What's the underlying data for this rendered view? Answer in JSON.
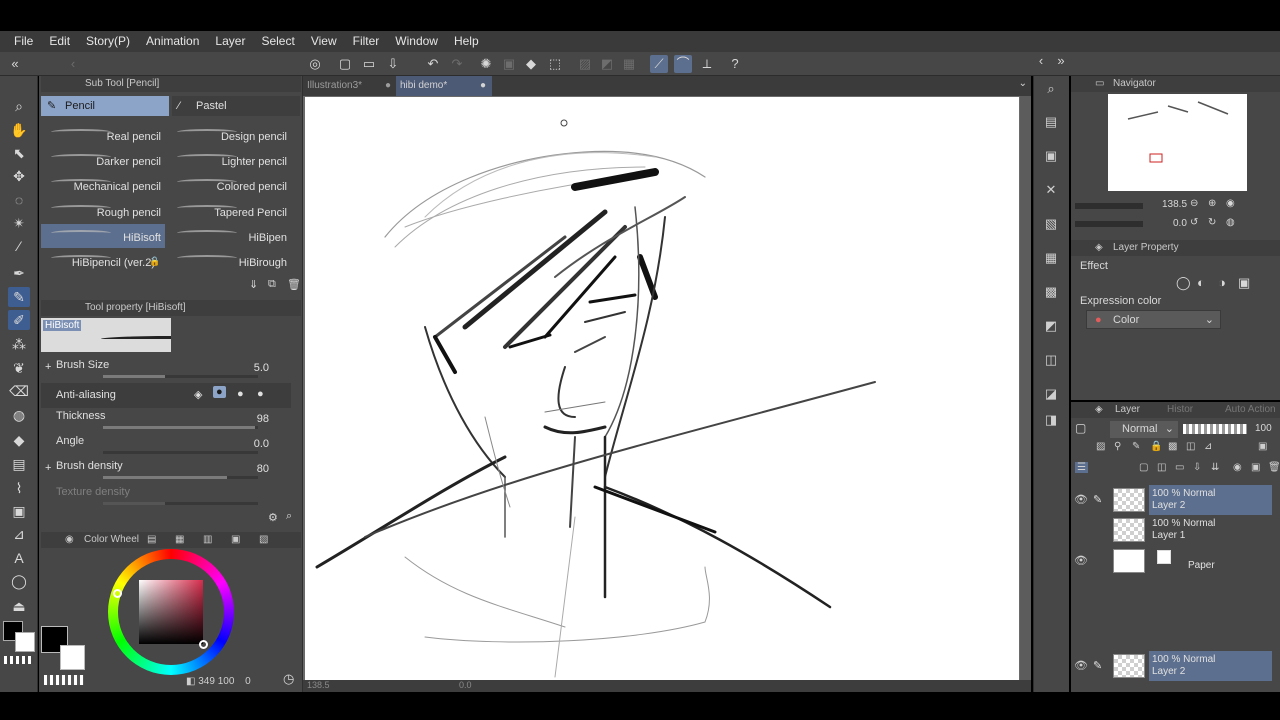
{
  "menu": [
    "File",
    "Edit",
    "Story(P)",
    "Animation",
    "Layer",
    "Select",
    "View",
    "Filter",
    "Window",
    "Help"
  ],
  "subtool": {
    "panel_title": "Sub Tool [Pencil]",
    "tabs": [
      "Pencil",
      "Pastel"
    ],
    "brushes": [
      "Real pencil",
      "Design pencil",
      "Darker pencil",
      "Lighter pencil",
      "Mechanical pencil",
      "Colored pencil",
      "Rough pencil",
      "Tapered Pencil",
      "HiBisoft",
      "HiBipen",
      "HiBipencil (ver.2)",
      "HiBirough"
    ],
    "active_brush": "HiBisoft"
  },
  "tool_property": {
    "title": "Tool property [HiBisoft]",
    "brush_name": "HiBisoft",
    "rows": [
      {
        "label": "Brush Size",
        "value": "5.0",
        "fill": 0.4
      },
      {
        "label": "Anti-aliasing",
        "value": "",
        "fill": 0
      },
      {
        "label": "Thickness",
        "value": "98",
        "fill": 0.98
      },
      {
        "label": "Angle",
        "value": "0.0",
        "fill": 0
      },
      {
        "label": "Brush density",
        "value": "80",
        "fill": 0.8
      },
      {
        "label": "Texture density",
        "value": "",
        "fill": 0.4
      }
    ]
  },
  "color_wheel": {
    "title": "Color Wheel",
    "main_color": "#000000",
    "sub_color": "#ffffff",
    "hue_color": "#d62d4c",
    "readout_h": "349",
    "readout_s": "100",
    "readout_v": "0"
  },
  "canvas": {
    "tabs": [
      "Illustration3*",
      "hibi demo*"
    ],
    "active_tab": "hibi demo*",
    "zoom": "138.5",
    "rotation": "0.0"
  },
  "navigator": {
    "title": "Navigator",
    "zoom": "138.5",
    "rotation": "0.0"
  },
  "layer_property": {
    "title": "Layer Property",
    "effect_label": "Effect",
    "expression_label": "Expression color",
    "expression_value": "Color"
  },
  "layer_panel": {
    "title": "Layer",
    "tabs_hidden": [
      "Histor",
      "Auto Action"
    ],
    "blend_mode": "Normal",
    "opacity": "100",
    "layers": [
      {
        "mode": "100 % Normal",
        "name": "Layer 2",
        "selected": true,
        "visible": true
      },
      {
        "mode": "100 % Normal",
        "name": "Layer 1",
        "selected": false,
        "visible": false
      },
      {
        "mode": "",
        "name": "Paper",
        "selected": false,
        "visible": true
      }
    ],
    "bottom_layer": {
      "mode": "100 % Normal",
      "name": "Layer 2"
    }
  }
}
